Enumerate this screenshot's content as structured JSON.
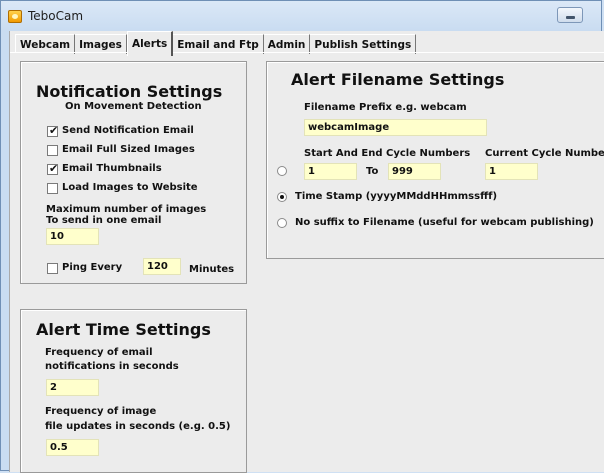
{
  "window": {
    "title": "TeboCam",
    "icon": "camera-app-icon"
  },
  "tabs": [
    {
      "label": "Webcam",
      "active": false
    },
    {
      "label": "Images",
      "active": false
    },
    {
      "label": "Alerts",
      "active": true
    },
    {
      "label": "Email and Ftp",
      "active": false
    },
    {
      "label": "Admin",
      "active": false
    },
    {
      "label": "Publish Settings",
      "active": false
    }
  ],
  "notification": {
    "title": "Notification Settings",
    "subtitle": "On Movement Detection",
    "send_email": {
      "label": "Send Notification Email",
      "checked": true
    },
    "full_sized": {
      "label": "Email Full Sized Images",
      "checked": false
    },
    "thumbnails": {
      "label": "Email Thumbnails",
      "checked": true
    },
    "load_website": {
      "label": "Load Images to Website",
      "checked": false
    },
    "max_images_line1": "Maximum number of images",
    "max_images_line2": "To send in one email",
    "max_images_value": "10",
    "ping": {
      "label": "Ping Every",
      "checked": false,
      "value": "120",
      "unit": "Minutes"
    }
  },
  "time": {
    "title": "Alert Time Settings",
    "email_freq_line1": "Frequency of email",
    "email_freq_line2": "notifications in seconds",
    "email_freq_value": "2",
    "image_freq_line1": "Frequency of image",
    "image_freq_line2": "file updates in seconds (e.g. 0.5)",
    "image_freq_value": "0.5"
  },
  "filename": {
    "title": "Alert Filename Settings",
    "prefix_label": "Filename Prefix e.g. webcam",
    "prefix_value": "webcamImage",
    "cycle_label": "Start And End Cycle Numbers",
    "current_cycle_label": "Current Cycle Number",
    "cycle_start": "1",
    "cycle_to": "To",
    "cycle_end": "999",
    "current_cycle": "1",
    "timestamp_label": "Time Stamp (yyyyMMddHHmmssfff)",
    "nosuffix_label": "No suffix to Filename (useful for webcam publishing)",
    "selected": "timestamp"
  }
}
